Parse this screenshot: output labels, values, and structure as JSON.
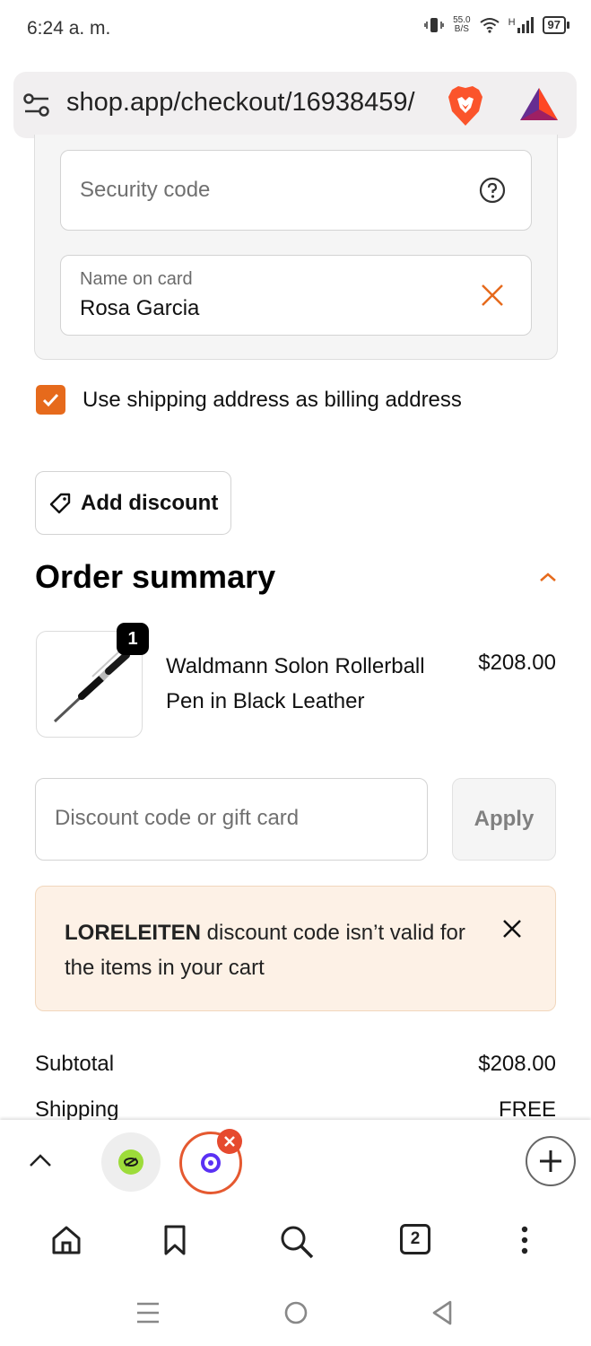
{
  "status_bar": {
    "time": "6:24 a. m.",
    "net_speed_value": "55.0",
    "net_speed_unit": "B/S",
    "signal_label": "H",
    "battery": "97"
  },
  "browser": {
    "url": "shop.app/checkout/16938459/"
  },
  "payment": {
    "security_code_placeholder": "Security code",
    "name_on_card_label": "Name on card",
    "name_on_card_value": "Rosa Garcia"
  },
  "billing": {
    "use_shipping_label": "Use shipping address as billing address",
    "checked": true
  },
  "discount_toggle": {
    "label": "Add discount"
  },
  "order_summary": {
    "title": "Order summary",
    "items": [
      {
        "quantity": "1",
        "name": "Waldmann Solon Rollerball Pen in Black Leather",
        "price": "$208.00"
      }
    ],
    "discount_input_placeholder": "Discount code or gift card",
    "apply_label": "Apply",
    "alert": {
      "code": "LORELEITEN",
      "message": " discount code isn’t valid for the items in your cart"
    },
    "subtotal_label": "Subtotal",
    "subtotal_value": "$208.00",
    "shipping_label": "Shipping",
    "shipping_value": "FREE"
  },
  "tab_strip": {
    "open_tabs_count": "2"
  },
  "colors": {
    "accent": "#e66a1c",
    "alert_bg": "#fdf1e6",
    "active_tab_ring": "#e55930"
  }
}
